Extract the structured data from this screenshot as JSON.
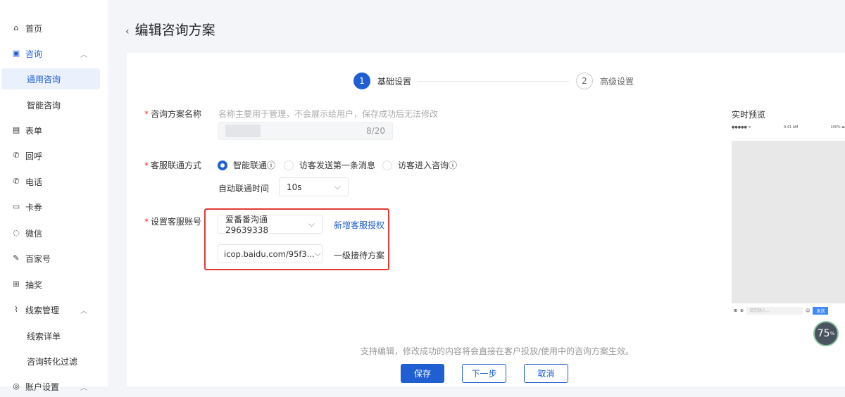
{
  "sidebar": {
    "items": [
      {
        "label": "首页",
        "icon": "home-icon"
      },
      {
        "label": "咨询",
        "icon": "chat-icon"
      },
      {
        "label": "通用咨询"
      },
      {
        "label": "智能咨询"
      },
      {
        "label": "表单",
        "icon": "form-icon"
      },
      {
        "label": "回呼",
        "icon": "callback-icon"
      },
      {
        "label": "电话",
        "icon": "phone-icon"
      },
      {
        "label": "卡券",
        "icon": "coupon-icon"
      },
      {
        "label": "微信",
        "icon": "wechat-icon"
      },
      {
        "label": "百家号",
        "icon": "baijiahao-icon"
      },
      {
        "label": "抽奖",
        "icon": "gift-icon"
      },
      {
        "label": "线索管理",
        "icon": "chart-icon"
      },
      {
        "label": "线索详单"
      },
      {
        "label": "咨询转化过滤"
      },
      {
        "label": "账户设置",
        "icon": "settings-icon"
      }
    ]
  },
  "page": {
    "title": "编辑咨询方案"
  },
  "steps": [
    {
      "num": "1",
      "label": "基础设置"
    },
    {
      "num": "2",
      "label": "高级设置"
    }
  ],
  "form": {
    "name_label": "咨询方案名称",
    "name_hint": "名称主要用于管理，不会展示给用户，保存成功后无法修改",
    "name_count": "8/20",
    "connect_label": "客服联通方式",
    "radios": [
      "智能联通",
      "访客发送第一条消息",
      "访客进入咨询"
    ],
    "auto_time_label": "自动联通时间",
    "auto_time_value": "10s",
    "account_label": "设置客服账号",
    "account_value": "爱番番沟通29639338",
    "add_auth_link": "新增客服授权",
    "plan_value": "icop.baidu.com/95f3...",
    "plan_label": "一级接待方案"
  },
  "preview": {
    "title": "实时预览",
    "time": "9:41 AM",
    "battery": "100%",
    "input_placeholder": "请您输入...",
    "send": "发送"
  },
  "footer": {
    "notice": "支持编辑，修改成功的内容将会直接在客户投放/使用中的咨询方案生效。",
    "save": "保存",
    "next": "下一步",
    "cancel": "取消"
  },
  "badge": {
    "value": "75",
    "unit": "%"
  }
}
